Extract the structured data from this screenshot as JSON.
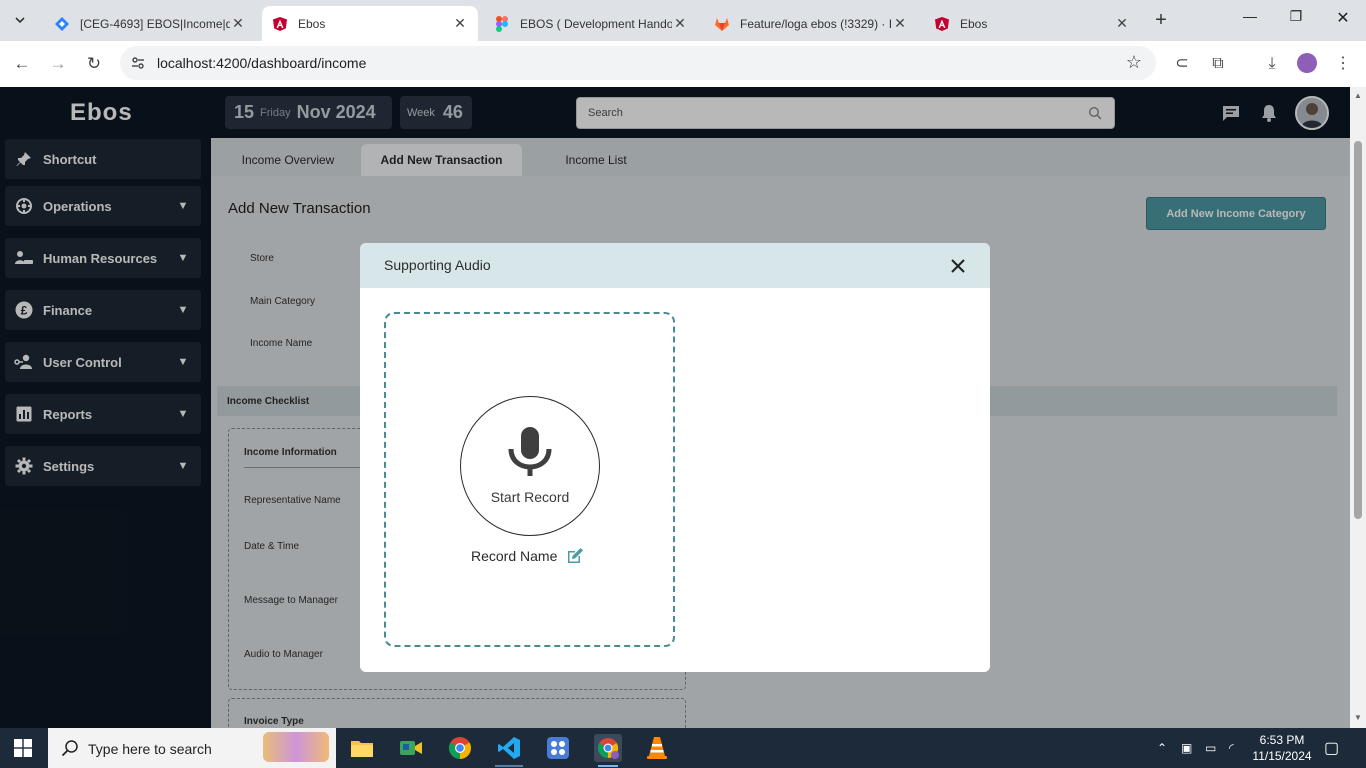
{
  "browser": {
    "tabs": [
      {
        "title": "[CEG-4693] EBOS|Income|de",
        "icon": "jira-icon"
      },
      {
        "title": "Ebos",
        "icon": "angular-icon",
        "active": true
      },
      {
        "title": "EBOS ( Development Handoff",
        "icon": "figma-icon"
      },
      {
        "title": "Feature/loga ebos (!3329) · I",
        "icon": "gitlab-icon"
      },
      {
        "title": "Ebos",
        "icon": "angular-icon"
      }
    ],
    "url": "localhost:4200/dashboard/income"
  },
  "header": {
    "logo": "Ebos",
    "date_day": "15",
    "date_weekday": "Friday",
    "date_month_year": "Nov 2024",
    "week_label": "Week",
    "week_number": "46",
    "search_placeholder": "Search"
  },
  "sidebar": {
    "items": [
      {
        "label": "Shortcut",
        "icon": "pin-icon",
        "expandable": false
      },
      {
        "label": "Operations",
        "icon": "operations-icon",
        "expandable": true
      },
      {
        "label": "Human Resources",
        "icon": "human-resources-icon",
        "expandable": true
      },
      {
        "label": "Finance",
        "icon": "pound-icon",
        "expandable": true
      },
      {
        "label": "User Control",
        "icon": "user-control-icon",
        "expandable": true
      },
      {
        "label": "Reports",
        "icon": "reports-icon",
        "expandable": true
      },
      {
        "label": "Settings",
        "icon": "gear-icon",
        "expandable": true
      }
    ]
  },
  "main": {
    "tabs": [
      {
        "label": "Income Overview"
      },
      {
        "label": "Add New Transaction",
        "active": true
      },
      {
        "label": "Income List"
      }
    ],
    "title": "Add New Transaction",
    "add_category_label": "Add New Income Category",
    "fields": [
      "Store",
      "Main Category",
      "Income Name"
    ],
    "checklist_label": "Income Checklist",
    "info_heading": "Income Information",
    "info_fields": [
      "Representative Name",
      "Date & Time",
      "Message to Manager",
      "Audio to Manager"
    ],
    "invoice_type_label": "Invoice Type"
  },
  "modal": {
    "title": "Supporting Audio",
    "start_record_label": "Start Record",
    "record_name_label": "Record Name"
  },
  "taskbar": {
    "search_placeholder": "Type here to search",
    "time": "6:53 PM",
    "date": "11/15/2024"
  },
  "colors": {
    "sidebar_bg": "#0c1823",
    "sidebar_item_bg": "#1e2a36",
    "accent_teal": "#4e9aa6",
    "modal_header_bg": "#d6e6e9",
    "recorder_border": "#4a8a95"
  }
}
